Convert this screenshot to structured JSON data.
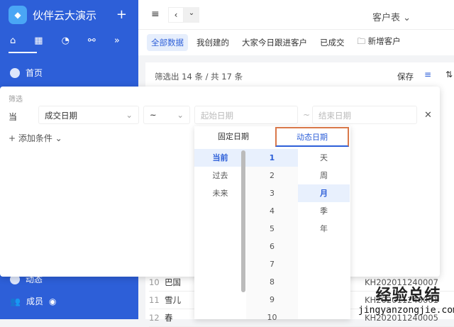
{
  "sidebar": {
    "app_name": "伙伴云大演示",
    "add": "+",
    "nav_icons": [
      "home-icon",
      "table-icon",
      "chart-icon",
      "flow-icon"
    ],
    "more": "»",
    "items": [
      {
        "label": "首页"
      },
      {
        "label": "动态"
      },
      {
        "label": "成员"
      }
    ]
  },
  "topbar": {
    "menu": "≡",
    "back": "‹",
    "dropdown": "⌄",
    "title": "客户表 ⌄"
  },
  "views": [
    "全部数据",
    "我创建的",
    "大家今日跟进客户",
    "已成交",
    "新增客户"
  ],
  "card": {
    "summary": "筛选出 14 条 / 共 17 条",
    "save": "保存",
    "filter_icon": "≡",
    "sort_icon": "⇅"
  },
  "filter": {
    "title": "筛选",
    "when": "当",
    "field": "成交日期",
    "operator": "~",
    "start_placeholder": "起始日期",
    "sep": "~",
    "end_placeholder": "结束日期",
    "close": "✕",
    "add_condition": "+ 添加条件 ⌄"
  },
  "date_picker": {
    "tabs": [
      "固定日期",
      "动态日期"
    ],
    "active_tab": "动态日期",
    "relative": [
      "当前",
      "过去",
      "未来"
    ],
    "numbers": [
      "1",
      "2",
      "3",
      "4",
      "5",
      "6",
      "7",
      "8",
      "9",
      "10"
    ],
    "units": [
      "天",
      "周",
      "月",
      "季",
      "年"
    ],
    "selected": {
      "relative": "当前",
      "number": "1",
      "unit": "月"
    }
  },
  "rows": [
    {
      "no": "10",
      "name": "巴国",
      "code": "KH202011240007"
    },
    {
      "no": "11",
      "name": "雪儿",
      "code": "KH202011240001"
    },
    {
      "no": "12",
      "name": "春",
      "code": "KH202011240005"
    }
  ],
  "watermark": {
    "cn": "经验总结",
    "url": "jingyanzongjie.com"
  }
}
